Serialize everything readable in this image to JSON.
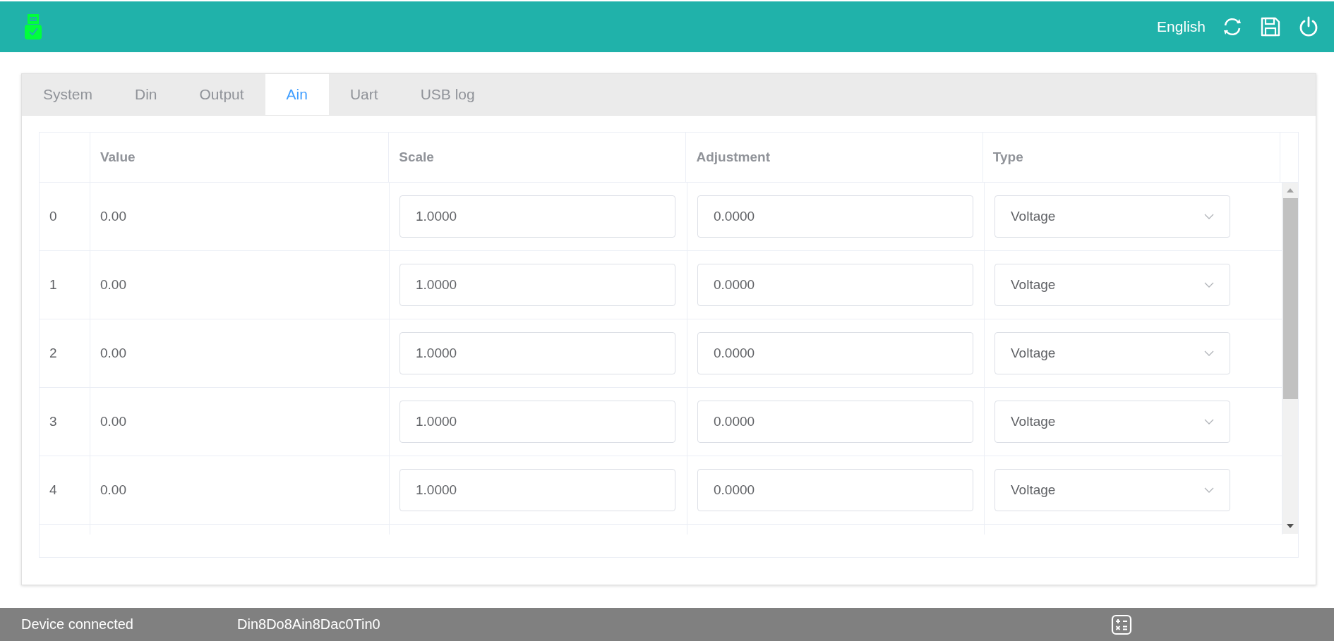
{
  "header": {
    "language": "English"
  },
  "tabs": [
    {
      "label": "System",
      "selected": false
    },
    {
      "label": "Din",
      "selected": false
    },
    {
      "label": "Output",
      "selected": false
    },
    {
      "label": "Ain",
      "selected": true
    },
    {
      "label": "Uart",
      "selected": false
    },
    {
      "label": "USB log",
      "selected": false
    }
  ],
  "table": {
    "columns": [
      "Value",
      "Scale",
      "Adjustment",
      "Type"
    ],
    "rows": [
      {
        "index": "0",
        "value": "0.00",
        "scale": "1.0000",
        "adjustment": "0.0000",
        "type": "Voltage"
      },
      {
        "index": "1",
        "value": "0.00",
        "scale": "1.0000",
        "adjustment": "0.0000",
        "type": "Voltage"
      },
      {
        "index": "2",
        "value": "0.00",
        "scale": "1.0000",
        "adjustment": "0.0000",
        "type": "Voltage"
      },
      {
        "index": "3",
        "value": "0.00",
        "scale": "1.0000",
        "adjustment": "0.0000",
        "type": "Voltage"
      },
      {
        "index": "4",
        "value": "0.00",
        "scale": "1.0000",
        "adjustment": "0.0000",
        "type": "Voltage"
      }
    ]
  },
  "status_bar": {
    "status": "Device connected",
    "device": "Din8Do8Ain8Dac0Tin0"
  }
}
